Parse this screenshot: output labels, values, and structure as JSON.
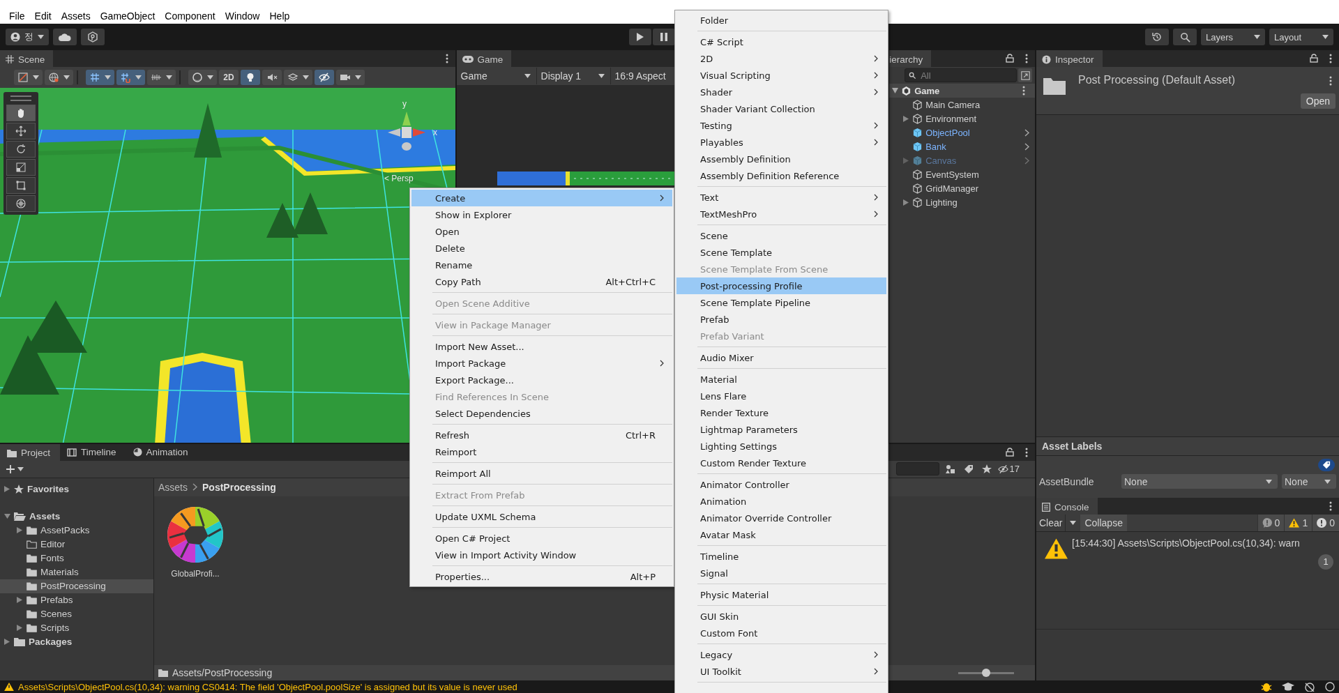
{
  "menu_bar": [
    "File",
    "Edit",
    "Assets",
    "GameObject",
    "Component",
    "Window",
    "Help"
  ],
  "toolbar": {
    "account": "정",
    "layers": "Layers",
    "layout": "Layout"
  },
  "scene": {
    "tab": "Scene",
    "toolbar": [
      {
        "selected": false,
        "dropdown": true
      },
      {
        "selected": false,
        "dropdown": true
      },
      {
        "selected": true,
        "dropdown": true
      },
      {
        "selected": true,
        "dropdown": true
      },
      {
        "selected": false,
        "dropdown": true
      },
      {
        "selected": false,
        "dropdown": true
      },
      {
        "label": "2D",
        "selected": false,
        "dropdown": false
      },
      {
        "selected": true,
        "dropdown": false
      },
      {
        "selected": false,
        "dropdown": false
      },
      {
        "selected": false,
        "dropdown": true
      },
      {
        "selected": true,
        "dropdown": false
      },
      {
        "selected": false,
        "dropdown": true
      }
    ],
    "tools": [
      {
        "selected": true
      },
      {
        "selected": false
      },
      {
        "selected": false
      },
      {
        "selected": false
      },
      {
        "selected": false
      },
      {
        "selected": false
      }
    ],
    "gizmo": {
      "y": "y",
      "x": "x",
      "projection": "< Persp"
    }
  },
  "game": {
    "tab": "Game",
    "mode": "Game",
    "display": "Display 1",
    "aspect": "16:9 Aspect"
  },
  "hierarchy": {
    "tab": "ierarchy",
    "search_placeholder": "All",
    "scene": "Game",
    "items": [
      {
        "label": "Main Camera",
        "kind": "object",
        "active": true
      },
      {
        "label": "Environment",
        "kind": "object",
        "active": true,
        "expanded": false
      },
      {
        "label": "ObjectPool",
        "kind": "prefab",
        "active": true
      },
      {
        "label": "Bank",
        "kind": "prefab",
        "active": true
      },
      {
        "label": "Canvas",
        "kind": "prefab",
        "active": false,
        "expanded": false
      },
      {
        "label": "EventSystem",
        "kind": "object",
        "active": true
      },
      {
        "label": "GridManager",
        "kind": "object",
        "active": true
      },
      {
        "label": "Lighting",
        "kind": "object",
        "active": true,
        "expanded": false
      }
    ]
  },
  "inspector": {
    "tab": "Inspector",
    "title": "Post Processing (Default Asset)",
    "open_button": "Open",
    "asset_labels": "Asset Labels",
    "asset_bundle": {
      "label": "AssetBundle",
      "name": "None",
      "variant": "None"
    }
  },
  "console": {
    "tab": "Console",
    "clear": "Clear",
    "collapse": "Collapse",
    "counts": [
      {
        "kind": "info",
        "count": "0"
      },
      {
        "kind": "warning",
        "count": "1"
      },
      {
        "kind": "error",
        "count": "0"
      }
    ],
    "entries": [
      {
        "kind": "warning",
        "text": "[15:44:30] Assets\\Scripts\\ObjectPool.cs(10,34): warn",
        "count": "1"
      }
    ]
  },
  "project": {
    "tabs": [
      {
        "label": "Project",
        "selected": true
      },
      {
        "label": "Timeline",
        "selected": false
      },
      {
        "label": "Animation",
        "selected": false
      }
    ],
    "hidden_count": "17",
    "tree": [
      {
        "label": "Favorites",
        "kind": "favorites",
        "expanded": false,
        "selected": false
      },
      {
        "label": "Assets",
        "kind": "root",
        "expanded": true,
        "selected": false,
        "children": [
          {
            "label": "AssetPacks",
            "expanded": false,
            "empty": false,
            "selected": false
          },
          {
            "label": "Editor",
            "empty": true,
            "selected": false
          },
          {
            "label": "Fonts",
            "empty": false,
            "selected": false
          },
          {
            "label": "Materials",
            "empty": false,
            "selected": false
          },
          {
            "label": "PostProcessing",
            "empty": false,
            "selected": true
          },
          {
            "label": "Prefabs",
            "expanded": false,
            "empty": false,
            "selected": false
          },
          {
            "label": "Scenes",
            "empty": false,
            "selected": false
          },
          {
            "label": "Scripts",
            "expanded": false,
            "empty": false,
            "selected": false
          }
        ]
      },
      {
        "label": "Packages",
        "kind": "root",
        "expanded": false,
        "selected": false
      }
    ],
    "breadcrumb": [
      "Assets",
      "PostProcessing"
    ],
    "assets": [
      {
        "name": "GlobalProfi..."
      }
    ],
    "footer_path": "Assets/PostProcessing",
    "zoom": {
      "level": 0.5
    }
  },
  "context_menu": {
    "groups": [
      [
        {
          "label": "Create",
          "submenu": true,
          "selected": true,
          "disabled": false
        },
        {
          "label": "Show in Explorer",
          "submenu": false,
          "selected": false,
          "disabled": false
        },
        {
          "label": "Open",
          "submenu": false,
          "selected": false,
          "disabled": false
        },
        {
          "label": "Delete",
          "submenu": false,
          "selected": false,
          "disabled": false
        },
        {
          "label": "Rename",
          "submenu": false,
          "selected": false,
          "disabled": false
        },
        {
          "label": "Copy Path",
          "shortcut": "Alt+Ctrl+C",
          "submenu": false,
          "selected": false,
          "disabled": false
        }
      ],
      [
        {
          "label": "Open Scene Additive",
          "submenu": false,
          "selected": false,
          "disabled": true
        }
      ],
      [
        {
          "label": "View in Package Manager",
          "submenu": false,
          "selected": false,
          "disabled": true
        }
      ],
      [
        {
          "label": "Import New Asset...",
          "submenu": false,
          "selected": false,
          "disabled": false
        },
        {
          "label": "Import Package",
          "submenu": true,
          "selected": false,
          "disabled": false
        },
        {
          "label": "Export Package...",
          "submenu": false,
          "selected": false,
          "disabled": false
        },
        {
          "label": "Find References In Scene",
          "submenu": false,
          "selected": false,
          "disabled": true
        },
        {
          "label": "Select Dependencies",
          "submenu": false,
          "selected": false,
          "disabled": false
        }
      ],
      [
        {
          "label": "Refresh",
          "shortcut": "Ctrl+R",
          "submenu": false,
          "selected": false,
          "disabled": false
        },
        {
          "label": "Reimport",
          "submenu": false,
          "selected": false,
          "disabled": false
        }
      ],
      [
        {
          "label": "Reimport All",
          "submenu": false,
          "selected": false,
          "disabled": false
        }
      ],
      [
        {
          "label": "Extract From Prefab",
          "submenu": false,
          "selected": false,
          "disabled": true
        }
      ],
      [
        {
          "label": "Update UXML Schema",
          "submenu": false,
          "selected": false,
          "disabled": false
        }
      ],
      [
        {
          "label": "Open C# Project",
          "submenu": false,
          "selected": false,
          "disabled": false
        },
        {
          "label": "View in Import Activity Window",
          "submenu": false,
          "selected": false,
          "disabled": false
        }
      ],
      [
        {
          "label": "Properties...",
          "shortcut": "Alt+P",
          "submenu": false,
          "selected": false,
          "disabled": false
        }
      ]
    ]
  },
  "create_menu": {
    "groups": [
      [
        {
          "label": "Folder",
          "submenu": false,
          "selected": false,
          "disabled": false
        }
      ],
      [
        {
          "label": "C# Script",
          "submenu": false,
          "selected": false,
          "disabled": false
        },
        {
          "label": "2D",
          "submenu": true,
          "selected": false,
          "disabled": false
        },
        {
          "label": "Visual Scripting",
          "submenu": true,
          "selected": false,
          "disabled": false
        },
        {
          "label": "Shader",
          "submenu": true,
          "selected": false,
          "disabled": false
        },
        {
          "label": "Shader Variant Collection",
          "submenu": false,
          "selected": false,
          "disabled": false
        },
        {
          "label": "Testing",
          "submenu": true,
          "selected": false,
          "disabled": false
        },
        {
          "label": "Playables",
          "submenu": true,
          "selected": false,
          "disabled": false
        },
        {
          "label": "Assembly Definition",
          "submenu": false,
          "selected": false,
          "disabled": false
        },
        {
          "label": "Assembly Definition Reference",
          "submenu": false,
          "selected": false,
          "disabled": false
        }
      ],
      [
        {
          "label": "Text",
          "submenu": true,
          "selected": false,
          "disabled": false
        },
        {
          "label": "TextMeshPro",
          "submenu": true,
          "selected": false,
          "disabled": false
        }
      ],
      [
        {
          "label": "Scene",
          "submenu": false,
          "selected": false,
          "disabled": false
        },
        {
          "label": "Scene Template",
          "submenu": false,
          "selected": false,
          "disabled": false
        },
        {
          "label": "Scene Template From Scene",
          "submenu": false,
          "selected": false,
          "disabled": true
        },
        {
          "label": "Post-processing Profile",
          "submenu": false,
          "selected": true,
          "disabled": false
        },
        {
          "label": "Scene Template Pipeline",
          "submenu": false,
          "selected": false,
          "disabled": false
        },
        {
          "label": "Prefab",
          "submenu": false,
          "selected": false,
          "disabled": false
        },
        {
          "label": "Prefab Variant",
          "submenu": false,
          "selected": false,
          "disabled": true
        }
      ],
      [
        {
          "label": "Audio Mixer",
          "submenu": false,
          "selected": false,
          "disabled": false
        }
      ],
      [
        {
          "label": "Material",
          "submenu": false,
          "selected": false,
          "disabled": false
        },
        {
          "label": "Lens Flare",
          "submenu": false,
          "selected": false,
          "disabled": false
        },
        {
          "label": "Render Texture",
          "submenu": false,
          "selected": false,
          "disabled": false
        },
        {
          "label": "Lightmap Parameters",
          "submenu": false,
          "selected": false,
          "disabled": false
        },
        {
          "label": "Lighting Settings",
          "submenu": false,
          "selected": false,
          "disabled": false
        },
        {
          "label": "Custom Render Texture",
          "submenu": false,
          "selected": false,
          "disabled": false
        }
      ],
      [
        {
          "label": "Animator Controller",
          "submenu": false,
          "selected": false,
          "disabled": false
        },
        {
          "label": "Animation",
          "submenu": false,
          "selected": false,
          "disabled": false
        },
        {
          "label": "Animator Override Controller",
          "submenu": false,
          "selected": false,
          "disabled": false
        },
        {
          "label": "Avatar Mask",
          "submenu": false,
          "selected": false,
          "disabled": false
        }
      ],
      [
        {
          "label": "Timeline",
          "submenu": false,
          "selected": false,
          "disabled": false
        },
        {
          "label": "Signal",
          "submenu": false,
          "selected": false,
          "disabled": false
        }
      ],
      [
        {
          "label": "Physic Material",
          "submenu": false,
          "selected": false,
          "disabled": false
        }
      ],
      [
        {
          "label": "GUI Skin",
          "submenu": false,
          "selected": false,
          "disabled": false
        },
        {
          "label": "Custom Font",
          "submenu": false,
          "selected": false,
          "disabled": false
        }
      ],
      [
        {
          "label": "Legacy",
          "submenu": true,
          "selected": false,
          "disabled": false
        },
        {
          "label": "UI Toolkit",
          "submenu": true,
          "selected": false,
          "disabled": false
        }
      ]
    ]
  },
  "status_bar": {
    "message": "Assets\\Scripts\\ObjectPool.cs(10,34): warning CS0414: The field 'ObjectPool.poolSize' is assigned but its value is never used"
  }
}
